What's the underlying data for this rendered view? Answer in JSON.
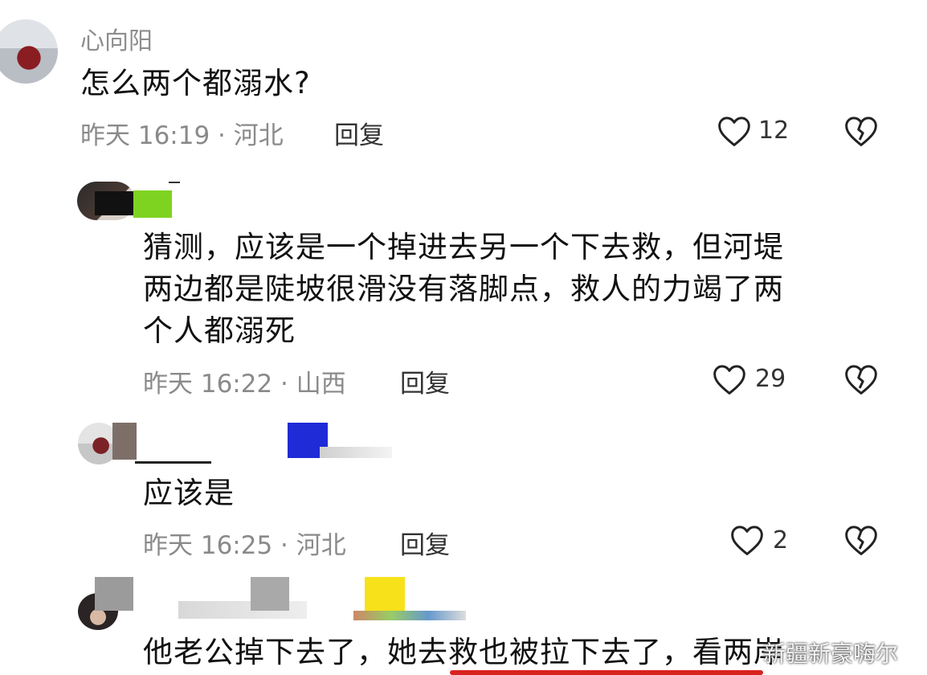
{
  "comments": [
    {
      "username": "心向阳",
      "text": "怎么两个都溺水?",
      "time_location": "昨天 16:19 · 河北",
      "reply_label": "回复",
      "likes": "12"
    },
    {
      "username": "",
      "text_lines": [
        "猜测，应该是一个掉进去另一个下去救，但河堤",
        "两边都是陡坡很滑没有落脚点，救人的力竭了两",
        "个人都溺死"
      ],
      "time_location": "昨天 16:22 · 山西",
      "reply_label": "回复",
      "likes": "29"
    },
    {
      "username": "",
      "text": "应该是",
      "time_location": "昨天 16:25 · 河北",
      "reply_label": "回复",
      "likes": "2"
    },
    {
      "username": "",
      "text": "他老公掉下去了，她去救也被拉下去了，看两岸"
    }
  ],
  "watermark": "新疆新豪嗨尔",
  "icons": {
    "like": "heart-outline-icon",
    "dislike": "broken-heart-icon"
  },
  "colors": {
    "censor_green": "#7ed321",
    "censor_blue": "#1f2bd6",
    "censor_yellow": "#f7e11b",
    "censor_gray": "#9b9b9b",
    "underline_red": "#d9231f"
  }
}
